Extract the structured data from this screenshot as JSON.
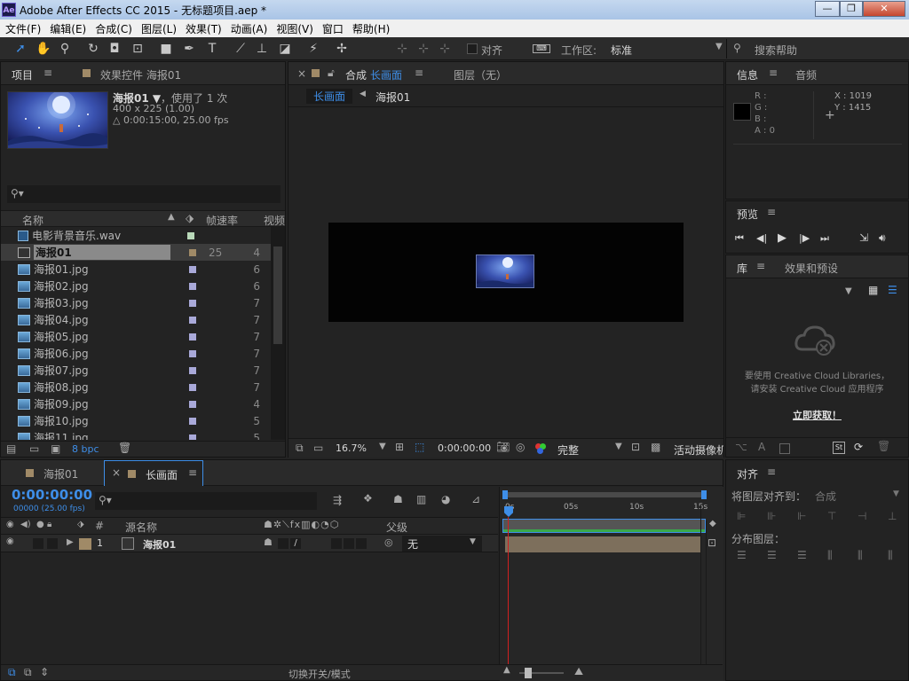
{
  "window": {
    "app_icon": "Ae",
    "title": "Adobe After Effects CC 2015 - 无标题项目.aep *",
    "buttons": [
      "—",
      "❐",
      "✕"
    ]
  },
  "menu": [
    "文件(F)",
    "编辑(E)",
    "合成(C)",
    "图层(L)",
    "效果(T)",
    "动画(A)",
    "视图(V)",
    "窗口",
    "帮助(H)"
  ],
  "toolbar": {
    "align_label": "对齐",
    "workspace_label": "工作区:",
    "workspace_value": "标准",
    "search_placeholder": "搜索帮助"
  },
  "project_panel": {
    "tab_project": "项目",
    "tab_effects": "效果控件 海报01",
    "selected_name": "海报01 ▼",
    "used_times": "，使用了 1 次",
    "dimensions": "400 x 225 (1.00)",
    "duration": "△ 0:00:15:00, 25.00 fps",
    "columns": {
      "name": "名称",
      "fps": "帧速率",
      "video": "视频"
    },
    "items": [
      {
        "name": "电影背景音乐.wav",
        "type": "audio",
        "fps": "",
        "vid": "",
        "label": "#b9d9b9"
      },
      {
        "name": "海报01",
        "type": "comp",
        "fps": "25",
        "vid": "4",
        "label": "#a08a67",
        "selected": true
      },
      {
        "name": "海报01.jpg",
        "type": "image",
        "fps": "",
        "vid": "6",
        "label": "#a9a9d9"
      },
      {
        "name": "海报02.jpg",
        "type": "image",
        "fps": "",
        "vid": "6",
        "label": "#a9a9d9"
      },
      {
        "name": "海报03.jpg",
        "type": "image",
        "fps": "",
        "vid": "7",
        "label": "#a9a9d9"
      },
      {
        "name": "海报04.jpg",
        "type": "image",
        "fps": "",
        "vid": "7",
        "label": "#a9a9d9"
      },
      {
        "name": "海报05.jpg",
        "type": "image",
        "fps": "",
        "vid": "7",
        "label": "#a9a9d9"
      },
      {
        "name": "海报06.jpg",
        "type": "image",
        "fps": "",
        "vid": "7",
        "label": "#a9a9d9"
      },
      {
        "name": "海报07.jpg",
        "type": "image",
        "fps": "",
        "vid": "7",
        "label": "#a9a9d9"
      },
      {
        "name": "海报08.jpg",
        "type": "image",
        "fps": "",
        "vid": "7",
        "label": "#a9a9d9"
      },
      {
        "name": "海报09.jpg",
        "type": "image",
        "fps": "",
        "vid": "4",
        "label": "#a9a9d9"
      },
      {
        "name": "海报10.jpg",
        "type": "image",
        "fps": "",
        "vid": "5",
        "label": "#a9a9d9"
      },
      {
        "name": "海报11.jpg",
        "type": "image",
        "fps": "",
        "vid": "5",
        "label": "#a9a9d9"
      }
    ],
    "bpc": "8 bpc"
  },
  "comp_panel": {
    "tab_prefix": "合成",
    "tab_name": "长画面",
    "tab_layer": "图层（无）",
    "breadcrumb_active": "长画面",
    "breadcrumb_child": "海报01",
    "zoom": "16.7%",
    "timecode": "0:00:00:00",
    "quality": "完整",
    "camera": "活动摄像机"
  },
  "info_panel": {
    "tab_info": "信息",
    "tab_audio": "音频",
    "r": "R :",
    "g": "G :",
    "b": "B :",
    "a": "A : 0",
    "x": "X : 1019",
    "y": "Y : 1415"
  },
  "preview_panel": {
    "title": "预览"
  },
  "library_panel": {
    "tab_library": "库",
    "tab_effects": "效果和预设",
    "message_line1": "要使用 Creative Cloud Libraries，",
    "message_line2": "请安装 Creative Cloud 应用程序",
    "link": "立即获取！"
  },
  "align_panel": {
    "title": "对齐",
    "align_to_label": "将图层对齐到：",
    "align_to_value": "合成",
    "distribute_label": "分布图层："
  },
  "timeline": {
    "tab_inactive": "海报01",
    "tab_active": "长画面",
    "timecode": "0:00:00:00",
    "frame_info": "00000 (25.00 fps)",
    "col_source": "源名称",
    "col_parent": "父级",
    "layer_index": "1",
    "layer_name": "海报01",
    "parent_value": "无",
    "ruler": [
      "0s",
      "05s",
      "10s",
      "15s"
    ],
    "footer_toggle": "切换开关/模式"
  },
  "colors": {
    "accent_blue": "#3e8ee8",
    "layer_bar": "#7d6f5c",
    "playhead": "#d02020",
    "work_area": "#3aa84a"
  }
}
